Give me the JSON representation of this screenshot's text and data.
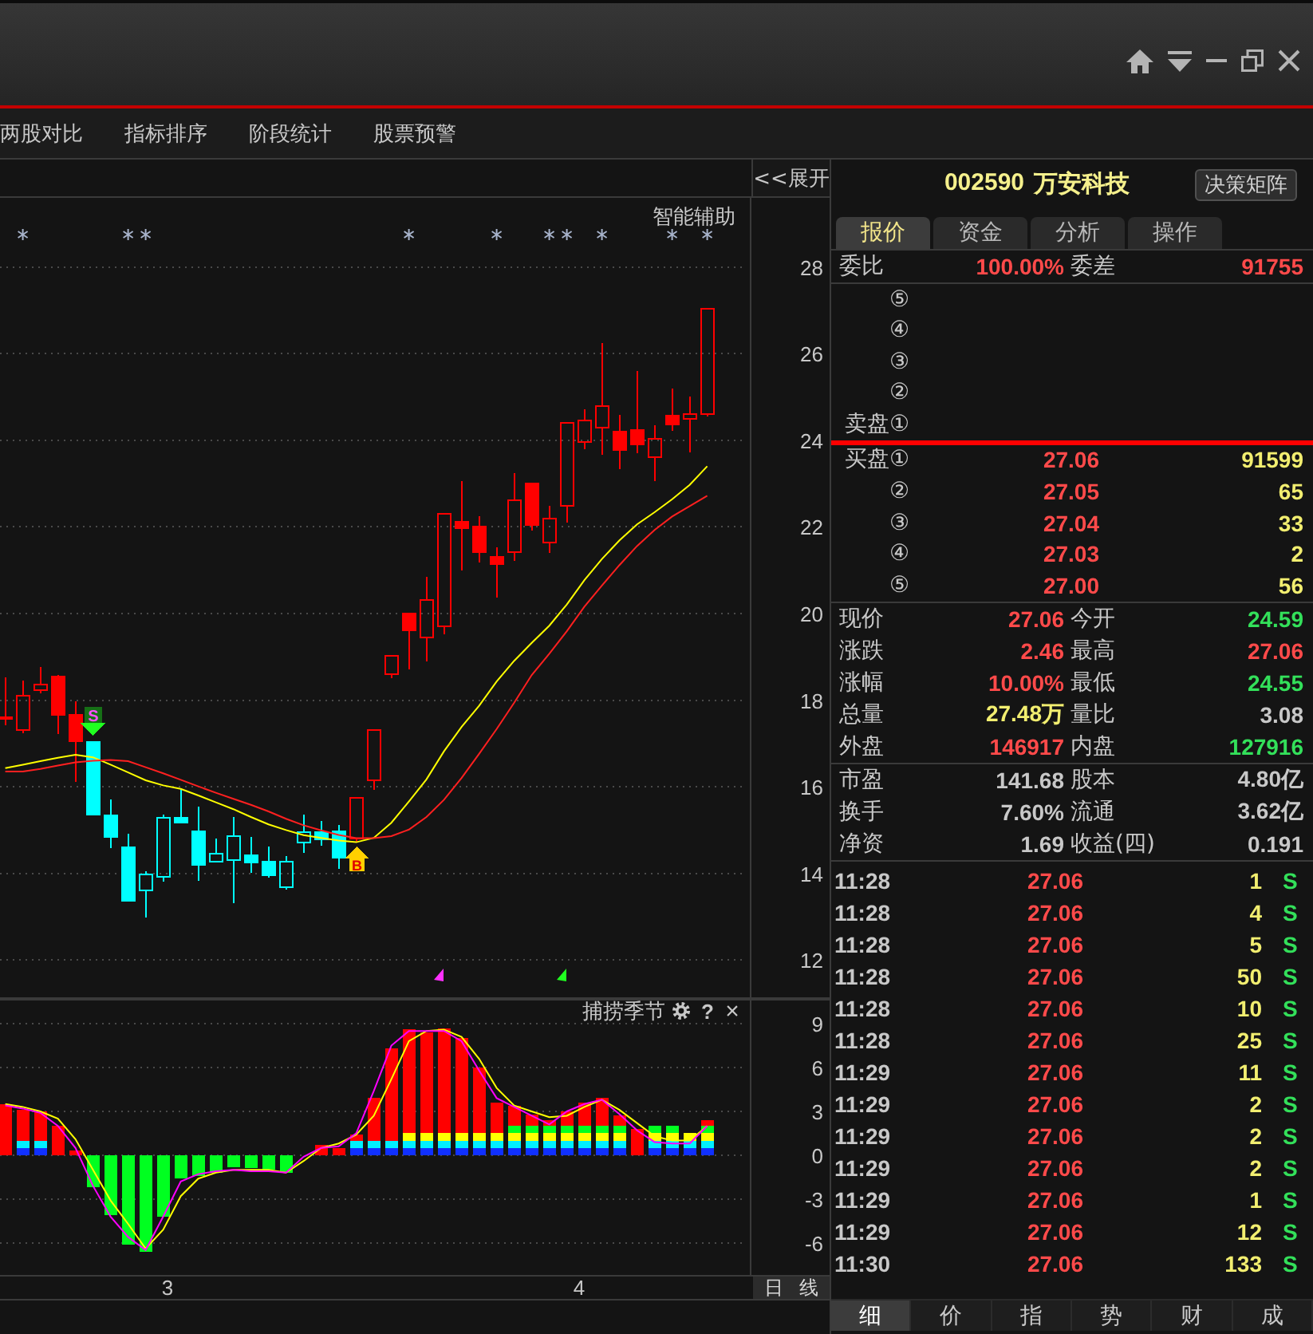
{
  "menu_bar": {
    "items": [
      "两股对比",
      "指标排序",
      "阶段统计",
      "股票预警"
    ]
  },
  "price_chart": {
    "expand_button": "<<展开",
    "indicator": "智能辅助",
    "sell_signal": "S",
    "buy_signal": "B",
    "chart_data": {
      "type": "candlestick",
      "ylim": [
        11.1,
        29.6
      ],
      "yticks": [
        12,
        14,
        16,
        18,
        20,
        22,
        24,
        26,
        28
      ],
      "grid": true,
      "ohlc": [
        [
          17.63,
          18.52,
          17.42,
          17.54
        ],
        [
          17.3,
          18.46,
          17.24,
          18.12
        ],
        [
          18.22,
          18.77,
          18.16,
          18.38
        ],
        [
          18.56,
          18.58,
          17.21,
          17.64
        ],
        [
          17.67,
          17.97,
          16.11,
          17.03
        ],
        [
          17.05,
          17.05,
          15.34,
          15.34
        ],
        [
          15.36,
          15.7,
          14.58,
          14.82
        ],
        [
          14.62,
          14.91,
          13.35,
          13.35
        ],
        [
          13.58,
          14.05,
          12.98,
          13.99
        ],
        [
          13.9,
          15.36,
          13.8,
          15.31
        ],
        [
          15.31,
          15.95,
          15.15,
          15.15
        ],
        [
          14.99,
          15.54,
          13.83,
          14.17
        ],
        [
          14.26,
          14.81,
          14.26,
          14.48
        ],
        [
          14.29,
          15.31,
          13.31,
          14.87
        ],
        [
          14.44,
          14.84,
          14.02,
          14.23
        ],
        [
          14.29,
          14.62,
          13.9,
          13.93
        ],
        [
          13.66,
          14.39,
          13.62,
          14.29
        ],
        [
          14.69,
          15.36,
          14.48,
          14.97
        ],
        [
          14.97,
          15.21,
          14.64,
          14.76
        ],
        [
          14.99,
          15.11,
          14.11,
          14.35
        ],
        [
          14.78,
          15.76,
          14.72,
          15.76
        ],
        [
          16.13,
          17.33,
          15.92,
          17.33
        ],
        [
          18.58,
          19.05,
          18.5,
          19.05
        ],
        [
          20.02,
          20.02,
          18.71,
          19.6
        ],
        [
          19.42,
          20.85,
          18.89,
          20.33
        ],
        [
          19.69,
          22.32,
          19.53,
          22.32
        ],
        [
          22.14,
          23.06,
          21.0,
          21.96
        ],
        [
          22.02,
          22.24,
          21.18,
          21.4
        ],
        [
          21.32,
          21.53,
          20.36,
          21.12
        ],
        [
          21.4,
          23.24,
          21.22,
          22.63
        ],
        [
          23.03,
          23.03,
          21.92,
          22.02
        ],
        [
          21.62,
          22.48,
          21.4,
          22.22
        ],
        [
          22.47,
          24.43,
          22.1,
          24.43
        ],
        [
          23.95,
          24.71,
          23.79,
          24.47
        ],
        [
          24.28,
          26.25,
          23.67,
          24.8
        ],
        [
          24.22,
          24.59,
          23.34,
          23.76
        ],
        [
          24.25,
          25.6,
          23.71,
          23.89
        ],
        [
          23.59,
          24.35,
          23.06,
          24.06
        ],
        [
          24.59,
          25.2,
          24.22,
          24.35
        ],
        [
          24.47,
          25.02,
          23.73,
          24.62
        ],
        [
          24.59,
          27.06,
          24.55,
          27.06
        ]
      ],
      "colors": [
        "#ff0000",
        "#ff0000",
        "#ff0000",
        "#ff0000",
        "#ff0000",
        "#00ffff",
        "#00ffff",
        "#00ffff",
        "#00ffff",
        "#00ffff",
        "#00ffff",
        "#00ffff",
        "#00ffff",
        "#00ffff",
        "#00ffff",
        "#00ffff",
        "#00ffff",
        "#00ffff",
        "#00ffff",
        "#00ffff",
        "#ff0000",
        "#ff0000",
        "#ff0000",
        "#ff0000",
        "#ff0000",
        "#ff0000",
        "#ff0000",
        "#ff0000",
        "#ff0000",
        "#ff0000",
        "#ff0000",
        "#ff0000",
        "#ff0000",
        "#ff0000",
        "#ff0000",
        "#ff0000",
        "#ff0000",
        "#ff0000",
        "#ff0000",
        "#ff0000",
        "#ff0000"
      ],
      "series": [
        {
          "type": "line",
          "color": "#ffff00",
          "values": [
            16.43,
            16.51,
            16.59,
            16.67,
            16.74,
            16.68,
            16.51,
            16.33,
            16.15,
            16.03,
            15.95,
            15.8,
            15.64,
            15.48,
            15.3,
            15.13,
            15.0,
            14.88,
            14.82,
            14.76,
            14.72,
            14.82,
            15.17,
            15.66,
            16.17,
            16.82,
            17.38,
            17.87,
            18.43,
            18.91,
            19.32,
            19.72,
            20.21,
            20.77,
            21.26,
            21.69,
            22.06,
            22.34,
            22.64,
            22.97,
            23.4
          ]
        },
        {
          "type": "line",
          "color": "#ff2020",
          "values": [
            16.35,
            16.35,
            16.41,
            16.49,
            16.56,
            16.6,
            16.62,
            16.59,
            16.45,
            16.31,
            16.16,
            16.01,
            15.86,
            15.72,
            15.58,
            15.43,
            15.26,
            15.11,
            14.99,
            14.89,
            14.81,
            14.81,
            14.86,
            15.01,
            15.3,
            15.7,
            16.2,
            16.76,
            17.33,
            17.94,
            18.58,
            19.07,
            19.59,
            20.16,
            20.65,
            21.12,
            21.56,
            21.93,
            22.24,
            22.48,
            22.72
          ]
        }
      ]
    }
  },
  "indicator_panel": {
    "title": "捕捞季节",
    "help_button": "?",
    "close_button": "×",
    "chart_data": {
      "type": "bar",
      "stacked": true,
      "ylim": [
        -8.2,
        10.7
      ],
      "yticks": [
        -6,
        -3,
        0,
        3,
        6,
        9
      ],
      "grid": true,
      "series": [
        {
          "color": "#1030ff",
          "values": [
            null,
            0.5,
            0.5,
            null,
            null,
            null,
            null,
            null,
            null,
            null,
            null,
            null,
            null,
            null,
            null,
            null,
            null,
            null,
            null,
            null,
            0.5,
            0.5,
            0.5,
            0.5,
            0.5,
            0.5,
            0.5,
            0.5,
            0.5,
            0.5,
            0.5,
            0.5,
            0.5,
            0.5,
            0.5,
            0.5,
            null,
            0.5,
            0.5,
            0.5,
            0.5
          ]
        },
        {
          "color": "#00f0ff",
          "values": [
            null,
            0.5,
            0.5,
            null,
            null,
            null,
            null,
            null,
            null,
            null,
            null,
            null,
            null,
            null,
            null,
            null,
            null,
            null,
            null,
            null,
            0.5,
            0.5,
            0.5,
            0.5,
            0.5,
            0.5,
            0.5,
            0.5,
            0.5,
            0.5,
            0.5,
            0.5,
            0.5,
            0.5,
            0.5,
            0.5,
            null,
            0.5,
            0.5,
            0.5,
            0.5
          ]
        },
        {
          "color": "#ffff00",
          "values": [
            null,
            null,
            null,
            null,
            null,
            null,
            null,
            null,
            null,
            null,
            null,
            null,
            null,
            null,
            null,
            null,
            null,
            null,
            null,
            null,
            null,
            null,
            null,
            0.5,
            0.5,
            0.5,
            0.5,
            0.5,
            0.5,
            0.5,
            0.5,
            0.5,
            0.5,
            0.5,
            0.5,
            0.5,
            null,
            0.5,
            0.5,
            0.5,
            0.5
          ]
        },
        {
          "color": "#00ff20",
          "values": [
            null,
            null,
            null,
            null,
            null,
            -2.2,
            -4.1,
            -6.1,
            -6.6,
            -4.2,
            -1.6,
            -1.4,
            -1.2,
            -0.8,
            -0.9,
            -1.0,
            -1.2,
            null,
            null,
            null,
            null,
            null,
            null,
            null,
            null,
            null,
            null,
            null,
            null,
            0.5,
            0.5,
            0.5,
            0.5,
            0.5,
            0.5,
            0.5,
            null,
            0.5,
            0.5,
            null,
            0.5
          ]
        },
        {
          "color": "#ff0000",
          "values": [
            3.5,
            2.1,
            2.0,
            2.0,
            0.3,
            null,
            null,
            null,
            null,
            null,
            null,
            null,
            null,
            null,
            null,
            null,
            null,
            null,
            0.7,
            0.5,
            0.4,
            2.9,
            6.3,
            7.1,
            6.9,
            7.2,
            6.5,
            4.5,
            2.1,
            1.4,
            0.8,
            0.4,
            1.0,
            1.6,
            1.9,
            0.7,
            1.8,
            null,
            null,
            null,
            0.4
          ]
        },
        {
          "type": "line",
          "color": "#ffff00",
          "values": [
            3.5,
            3.3,
            3.0,
            2.5,
            1.1,
            -1.0,
            -3.1,
            -4.7,
            -6.4,
            -5.1,
            -2.8,
            -1.6,
            -1.2,
            -1.0,
            -1.0,
            -1.0,
            -1.2,
            -0.4,
            0.5,
            0.8,
            1.4,
            2.7,
            5.2,
            7.8,
            8.5,
            8.6,
            8.1,
            6.6,
            4.6,
            3.4,
            3.0,
            2.6,
            2.7,
            3.3,
            3.8,
            3.1,
            2.2,
            1.3,
            1.0,
            1.0,
            2.0
          ]
        },
        {
          "type": "line",
          "color": "#ff00ff",
          "values": [
            3.4,
            3.2,
            2.9,
            2.0,
            0.5,
            -2.1,
            -4.2,
            -5.6,
            -6.5,
            -4.2,
            -1.8,
            -1.3,
            -1.1,
            -1.0,
            -1.1,
            -1.1,
            -1.2,
            -0.1,
            0.5,
            0.6,
            1.5,
            4.4,
            7.5,
            8.5,
            8.5,
            8.5,
            7.8,
            5.8,
            3.9,
            3.3,
            2.7,
            2.1,
            3.0,
            3.5,
            3.8,
            2.8,
            1.7,
            0.9,
            0.8,
            0.8,
            2.0
          ]
        }
      ]
    }
  },
  "time_axis": {
    "labels": [
      "3",
      "4"
    ],
    "period_button": "日 线"
  },
  "quote": {
    "code": "002590",
    "name": "万安科技",
    "matrix_button": "决策矩阵",
    "tabs": [
      {
        "label": "报价",
        "selected": true
      },
      {
        "label": "资金",
        "selected": false
      },
      {
        "label": "分析",
        "selected": false
      },
      {
        "label": "操作",
        "selected": false
      }
    ],
    "commission": {
      "ratio_label": "委比",
      "ratio": "100.00%",
      "diff_label": "委差",
      "diff": "91755"
    },
    "ask_levels": [
      "⑤",
      "④",
      "③",
      "②",
      "卖盘①"
    ],
    "bid_levels": [
      {
        "label": "买盘①",
        "price": "27.06",
        "volume": "91599"
      },
      {
        "label": "②",
        "price": "27.05",
        "volume": "65"
      },
      {
        "label": "③",
        "price": "27.04",
        "volume": "33"
      },
      {
        "label": "④",
        "price": "27.03",
        "volume": "2"
      },
      {
        "label": "⑤",
        "price": "27.00",
        "volume": "56"
      }
    ],
    "stats": [
      {
        "label": "现价",
        "value": "27.06",
        "color": "#ff4a4a"
      },
      {
        "label": "今开",
        "value": "24.59",
        "color": "#33e05a"
      },
      {
        "label": "涨跌",
        "value": "2.46",
        "color": "#ff4a4a"
      },
      {
        "label": "最高",
        "value": "27.06",
        "color": "#ff4a4a"
      },
      {
        "label": "涨幅",
        "value": "10.00%",
        "color": "#ff4a4a"
      },
      {
        "label": "最低",
        "value": "24.55",
        "color": "#33e05a"
      },
      {
        "label": "总量",
        "value": "27.48万",
        "color": "#f2ee70"
      },
      {
        "label": "量比",
        "value": "3.08",
        "color": "#c8c8c8"
      },
      {
        "label": "外盘",
        "value": "146917",
        "color": "#ff4a4a"
      },
      {
        "label": "内盘",
        "value": "127916",
        "color": "#33e05a"
      }
    ],
    "fundamentals": [
      {
        "label": "市盈",
        "value": "141.68"
      },
      {
        "label": "股本",
        "value": "4.80亿"
      },
      {
        "label": "换手",
        "value": "7.60%"
      },
      {
        "label": "流通",
        "value": "3.62亿"
      },
      {
        "label": "净资",
        "value": "1.69"
      },
      {
        "label": "收益(四)",
        "value": "0.191"
      }
    ],
    "trades": [
      {
        "time": "11:28",
        "price": "27.06",
        "volume": "1",
        "side": "S"
      },
      {
        "time": "11:28",
        "price": "27.06",
        "volume": "4",
        "side": "S"
      },
      {
        "time": "11:28",
        "price": "27.06",
        "volume": "5",
        "side": "S"
      },
      {
        "time": "11:28",
        "price": "27.06",
        "volume": "50",
        "side": "S"
      },
      {
        "time": "11:28",
        "price": "27.06",
        "volume": "10",
        "side": "S"
      },
      {
        "time": "11:28",
        "price": "27.06",
        "volume": "25",
        "side": "S"
      },
      {
        "time": "11:29",
        "price": "27.06",
        "volume": "11",
        "side": "S"
      },
      {
        "time": "11:29",
        "price": "27.06",
        "volume": "2",
        "side": "S"
      },
      {
        "time": "11:29",
        "price": "27.06",
        "volume": "2",
        "side": "S"
      },
      {
        "time": "11:29",
        "price": "27.06",
        "volume": "2",
        "side": "S"
      },
      {
        "time": "11:29",
        "price": "27.06",
        "volume": "1",
        "side": "S"
      },
      {
        "time": "11:29",
        "price": "27.06",
        "volume": "12",
        "side": "S"
      },
      {
        "time": "11:30",
        "price": "27.06",
        "volume": "133",
        "side": "S"
      }
    ],
    "bottom_tabs": [
      {
        "label": "细",
        "selected": true
      },
      {
        "label": "价",
        "selected": false
      },
      {
        "label": "指",
        "selected": false
      },
      {
        "label": "势",
        "selected": false
      },
      {
        "label": "财",
        "selected": false
      },
      {
        "label": "成",
        "selected": false
      }
    ]
  }
}
